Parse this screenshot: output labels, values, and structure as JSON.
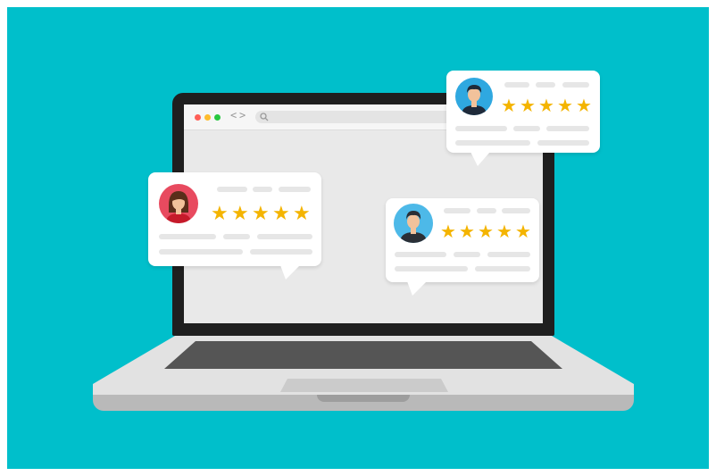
{
  "colors": {
    "background": "#00bfcb",
    "bezel": "#1f1f1f",
    "screen": "#e9e9e9",
    "star": "#f4b400",
    "card": "#ffffff",
    "placeholder": "#e6e6e6",
    "window_dots": [
      "#ff5f57",
      "#febc2e",
      "#28c840"
    ]
  },
  "browser": {
    "nav_back_glyph": "<",
    "nav_forward_glyph": ">",
    "search_icon": "search-icon"
  },
  "reviews": [
    {
      "reviewer": "woman",
      "avatar_bg": "#e84a5f",
      "rating": 5,
      "max_rating": 5
    },
    {
      "reviewer": "man",
      "avatar_bg": "#2fa8e0",
      "rating": 5,
      "max_rating": 5
    },
    {
      "reviewer": "man",
      "avatar_bg": "#4db9e8",
      "rating": 5,
      "max_rating": 5
    }
  ]
}
